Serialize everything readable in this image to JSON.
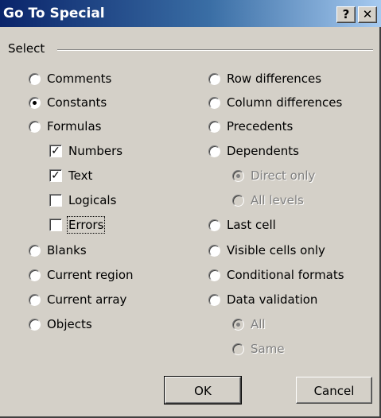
{
  "window": {
    "title": "Go To Special",
    "help_label": "?",
    "close_label": "✕"
  },
  "group": {
    "label": "Select"
  },
  "left_options": [
    {
      "label": "Comments",
      "type": "radio",
      "checked": false
    },
    {
      "label": "Constants",
      "type": "radio",
      "checked": true
    },
    {
      "label": "Formulas",
      "type": "radio",
      "checked": false
    },
    {
      "label": "Numbers",
      "type": "checkbox",
      "checked": true
    },
    {
      "label": "Text",
      "type": "checkbox",
      "checked": true
    },
    {
      "label": "Logicals",
      "type": "checkbox",
      "checked": false
    },
    {
      "label": "Errors",
      "type": "checkbox",
      "checked": false
    },
    {
      "label": "Blanks",
      "type": "radio",
      "checked": false
    },
    {
      "label": "Current region",
      "type": "radio",
      "checked": false
    },
    {
      "label": "Current array",
      "type": "radio",
      "checked": false
    },
    {
      "label": "Objects",
      "type": "radio",
      "checked": false
    }
  ],
  "right_options": [
    {
      "label": "Row differences",
      "type": "radio",
      "checked": false
    },
    {
      "label": "Column differences",
      "type": "radio",
      "checked": false
    },
    {
      "label": "Precedents",
      "type": "radio",
      "checked": false
    },
    {
      "label": "Dependents",
      "type": "radio",
      "checked": false
    },
    {
      "label": "Direct only",
      "type": "radio",
      "checked": true,
      "disabled": true
    },
    {
      "label": "All levels",
      "type": "radio",
      "checked": false,
      "disabled": true
    },
    {
      "label": "Last cell",
      "type": "radio",
      "checked": false
    },
    {
      "label": "Visible cells only",
      "type": "radio",
      "checked": false
    },
    {
      "label": "Conditional formats",
      "type": "radio",
      "checked": false
    },
    {
      "label": "Data validation",
      "type": "radio",
      "checked": false
    },
    {
      "label": "All",
      "type": "radio",
      "checked": true,
      "disabled": true
    },
    {
      "label": "Same",
      "type": "radio",
      "checked": false,
      "disabled": true
    }
  ],
  "buttons": {
    "ok": "OK",
    "cancel": "Cancel"
  },
  "colors": {
    "titlebar_start": "#0a246a",
    "titlebar_end": "#a6caf0",
    "face": "#d4d0c8"
  }
}
